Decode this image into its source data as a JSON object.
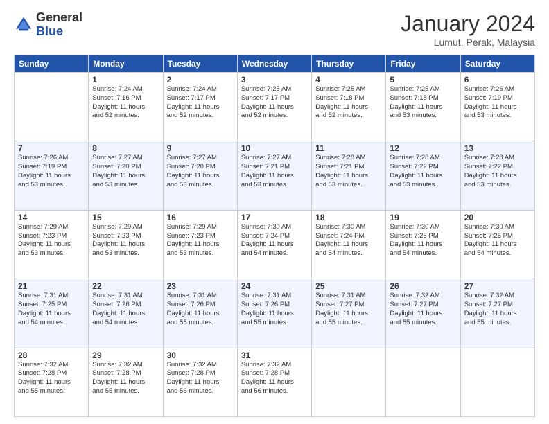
{
  "header": {
    "logo_general": "General",
    "logo_blue": "Blue",
    "title": "January 2024",
    "subtitle": "Lumut, Perak, Malaysia"
  },
  "days_of_week": [
    "Sunday",
    "Monday",
    "Tuesday",
    "Wednesday",
    "Thursday",
    "Friday",
    "Saturday"
  ],
  "weeks": [
    [
      {
        "day": "",
        "info": ""
      },
      {
        "day": "1",
        "info": "Sunrise: 7:24 AM\nSunset: 7:16 PM\nDaylight: 11 hours\nand 52 minutes."
      },
      {
        "day": "2",
        "info": "Sunrise: 7:24 AM\nSunset: 7:17 PM\nDaylight: 11 hours\nand 52 minutes."
      },
      {
        "day": "3",
        "info": "Sunrise: 7:25 AM\nSunset: 7:17 PM\nDaylight: 11 hours\nand 52 minutes."
      },
      {
        "day": "4",
        "info": "Sunrise: 7:25 AM\nSunset: 7:18 PM\nDaylight: 11 hours\nand 52 minutes."
      },
      {
        "day": "5",
        "info": "Sunrise: 7:25 AM\nSunset: 7:18 PM\nDaylight: 11 hours\nand 53 minutes."
      },
      {
        "day": "6",
        "info": "Sunrise: 7:26 AM\nSunset: 7:19 PM\nDaylight: 11 hours\nand 53 minutes."
      }
    ],
    [
      {
        "day": "7",
        "info": "Sunrise: 7:26 AM\nSunset: 7:19 PM\nDaylight: 11 hours\nand 53 minutes."
      },
      {
        "day": "8",
        "info": "Sunrise: 7:27 AM\nSunset: 7:20 PM\nDaylight: 11 hours\nand 53 minutes."
      },
      {
        "day": "9",
        "info": "Sunrise: 7:27 AM\nSunset: 7:20 PM\nDaylight: 11 hours\nand 53 minutes."
      },
      {
        "day": "10",
        "info": "Sunrise: 7:27 AM\nSunset: 7:21 PM\nDaylight: 11 hours\nand 53 minutes."
      },
      {
        "day": "11",
        "info": "Sunrise: 7:28 AM\nSunset: 7:21 PM\nDaylight: 11 hours\nand 53 minutes."
      },
      {
        "day": "12",
        "info": "Sunrise: 7:28 AM\nSunset: 7:22 PM\nDaylight: 11 hours\nand 53 minutes."
      },
      {
        "day": "13",
        "info": "Sunrise: 7:28 AM\nSunset: 7:22 PM\nDaylight: 11 hours\nand 53 minutes."
      }
    ],
    [
      {
        "day": "14",
        "info": "Sunrise: 7:29 AM\nSunset: 7:23 PM\nDaylight: 11 hours\nand 53 minutes."
      },
      {
        "day": "15",
        "info": "Sunrise: 7:29 AM\nSunset: 7:23 PM\nDaylight: 11 hours\nand 53 minutes."
      },
      {
        "day": "16",
        "info": "Sunrise: 7:29 AM\nSunset: 7:23 PM\nDaylight: 11 hours\nand 53 minutes."
      },
      {
        "day": "17",
        "info": "Sunrise: 7:30 AM\nSunset: 7:24 PM\nDaylight: 11 hours\nand 54 minutes."
      },
      {
        "day": "18",
        "info": "Sunrise: 7:30 AM\nSunset: 7:24 PM\nDaylight: 11 hours\nand 54 minutes."
      },
      {
        "day": "19",
        "info": "Sunrise: 7:30 AM\nSunset: 7:25 PM\nDaylight: 11 hours\nand 54 minutes."
      },
      {
        "day": "20",
        "info": "Sunrise: 7:30 AM\nSunset: 7:25 PM\nDaylight: 11 hours\nand 54 minutes."
      }
    ],
    [
      {
        "day": "21",
        "info": "Sunrise: 7:31 AM\nSunset: 7:25 PM\nDaylight: 11 hours\nand 54 minutes."
      },
      {
        "day": "22",
        "info": "Sunrise: 7:31 AM\nSunset: 7:26 PM\nDaylight: 11 hours\nand 54 minutes."
      },
      {
        "day": "23",
        "info": "Sunrise: 7:31 AM\nSunset: 7:26 PM\nDaylight: 11 hours\nand 55 minutes."
      },
      {
        "day": "24",
        "info": "Sunrise: 7:31 AM\nSunset: 7:26 PM\nDaylight: 11 hours\nand 55 minutes."
      },
      {
        "day": "25",
        "info": "Sunrise: 7:31 AM\nSunset: 7:27 PM\nDaylight: 11 hours\nand 55 minutes."
      },
      {
        "day": "26",
        "info": "Sunrise: 7:32 AM\nSunset: 7:27 PM\nDaylight: 11 hours\nand 55 minutes."
      },
      {
        "day": "27",
        "info": "Sunrise: 7:32 AM\nSunset: 7:27 PM\nDaylight: 11 hours\nand 55 minutes."
      }
    ],
    [
      {
        "day": "28",
        "info": "Sunrise: 7:32 AM\nSunset: 7:28 PM\nDaylight: 11 hours\nand 55 minutes."
      },
      {
        "day": "29",
        "info": "Sunrise: 7:32 AM\nSunset: 7:28 PM\nDaylight: 11 hours\nand 55 minutes."
      },
      {
        "day": "30",
        "info": "Sunrise: 7:32 AM\nSunset: 7:28 PM\nDaylight: 11 hours\nand 56 minutes."
      },
      {
        "day": "31",
        "info": "Sunrise: 7:32 AM\nSunset: 7:28 PM\nDaylight: 11 hours\nand 56 minutes."
      },
      {
        "day": "",
        "info": ""
      },
      {
        "day": "",
        "info": ""
      },
      {
        "day": "",
        "info": ""
      }
    ]
  ]
}
